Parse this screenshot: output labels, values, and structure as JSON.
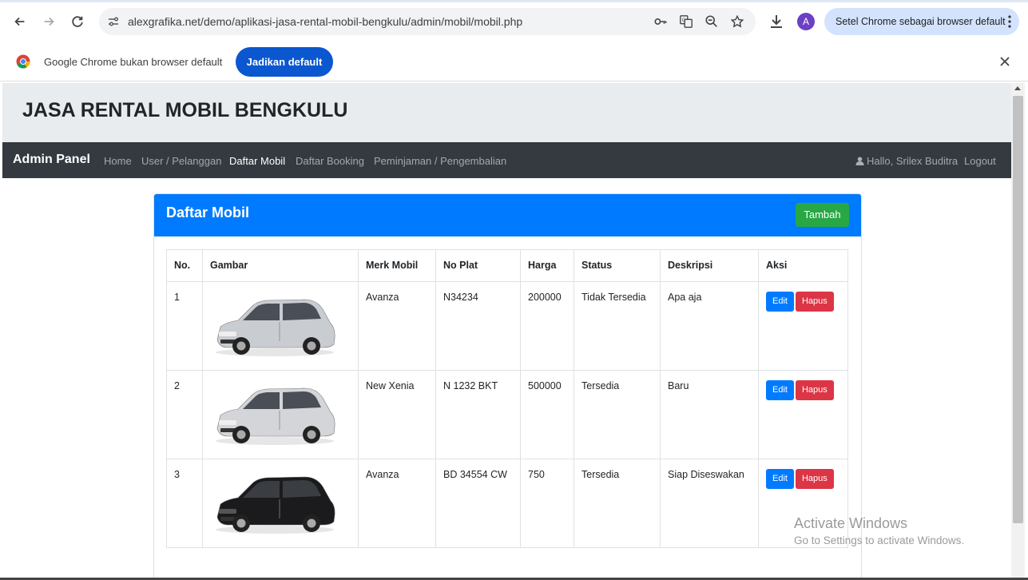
{
  "browser": {
    "url": "alexgrafika.net/demo/aplikasi-jasa-rental-mobil-bengkulu/admin/mobil/mobil.php",
    "profile_initial": "A",
    "set_default_label": "Setel Chrome sebagai browser default",
    "infobar_text": "Google Chrome bukan browser default",
    "infobar_button": "Jadikan default"
  },
  "site": {
    "title": "JASA RENTAL MOBIL BENGKULU"
  },
  "navbar": {
    "brand": "Admin Panel",
    "links": [
      "Home",
      "User / Pelanggan",
      "Daftar Mobil",
      "Daftar Booking",
      "Peminjaman / Pengembalian"
    ],
    "active": "Daftar Mobil",
    "user": "Hallo, Srilex Buditra",
    "logout": "Logout"
  },
  "card": {
    "title": "Daftar Mobil",
    "add_button": "Tambah"
  },
  "table": {
    "headers": [
      "No.",
      "Gambar",
      "Merk Mobil",
      "No Plat",
      "Harga",
      "Status",
      "Deskripsi",
      "Aksi"
    ],
    "rows": [
      {
        "no": "1",
        "merk": "Avanza",
        "plat": "N34234",
        "harga": "200000",
        "status": "Tidak Tersedia",
        "deskripsi": "Apa aja",
        "car_color": "#c9ccd1"
      },
      {
        "no": "2",
        "merk": "New Xenia",
        "plat": "N 1232 BKT",
        "harga": "500000",
        "status": "Tersedia",
        "deskripsi": "Baru",
        "car_color": "#d3d5d8"
      },
      {
        "no": "3",
        "merk": "Avanza",
        "plat": "BD 34554 CW",
        "harga": "750",
        "status": "Tersedia",
        "deskripsi": "Siap Diseswakan",
        "car_color": "#1b1b1d"
      }
    ],
    "edit_label": "Edit",
    "delete_label": "Hapus"
  },
  "watermark": {
    "line1": "Activate Windows",
    "line2": "Go to Settings to activate Windows."
  }
}
